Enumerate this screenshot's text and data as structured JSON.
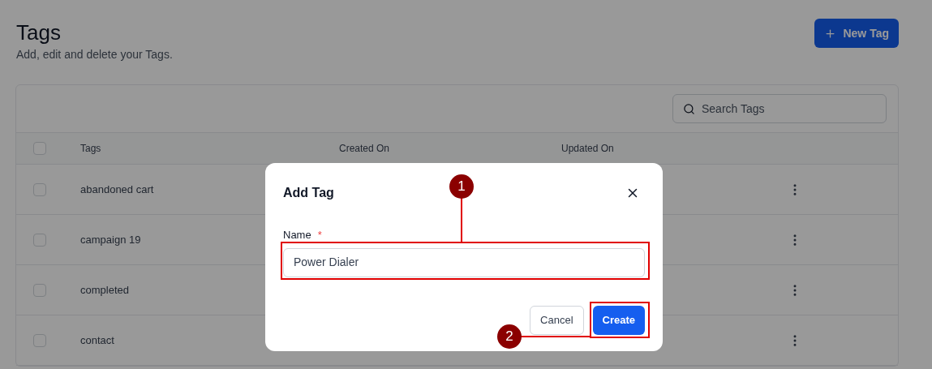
{
  "page": {
    "title": "Tags",
    "subtitle": "Add, edit and delete your Tags.",
    "new_button": "New Tag"
  },
  "search": {
    "placeholder": "Search Tags"
  },
  "table": {
    "select_all_checked": false,
    "columns": [
      "Tags",
      "Created On",
      "Updated On"
    ],
    "rows": [
      {
        "tag": "abandoned cart",
        "checked": false
      },
      {
        "tag": "campaign 19",
        "checked": false
      },
      {
        "tag": "completed",
        "checked": false
      },
      {
        "tag": "contact",
        "checked": false
      }
    ]
  },
  "dialog": {
    "title": "Add Tag",
    "field_label": "Name",
    "required_mark": "*",
    "value": "Power Dialer",
    "buttons": [
      "Cancel",
      "Create"
    ]
  },
  "annotations": [
    {
      "label": "1"
    },
    {
      "label": "2"
    }
  ]
}
